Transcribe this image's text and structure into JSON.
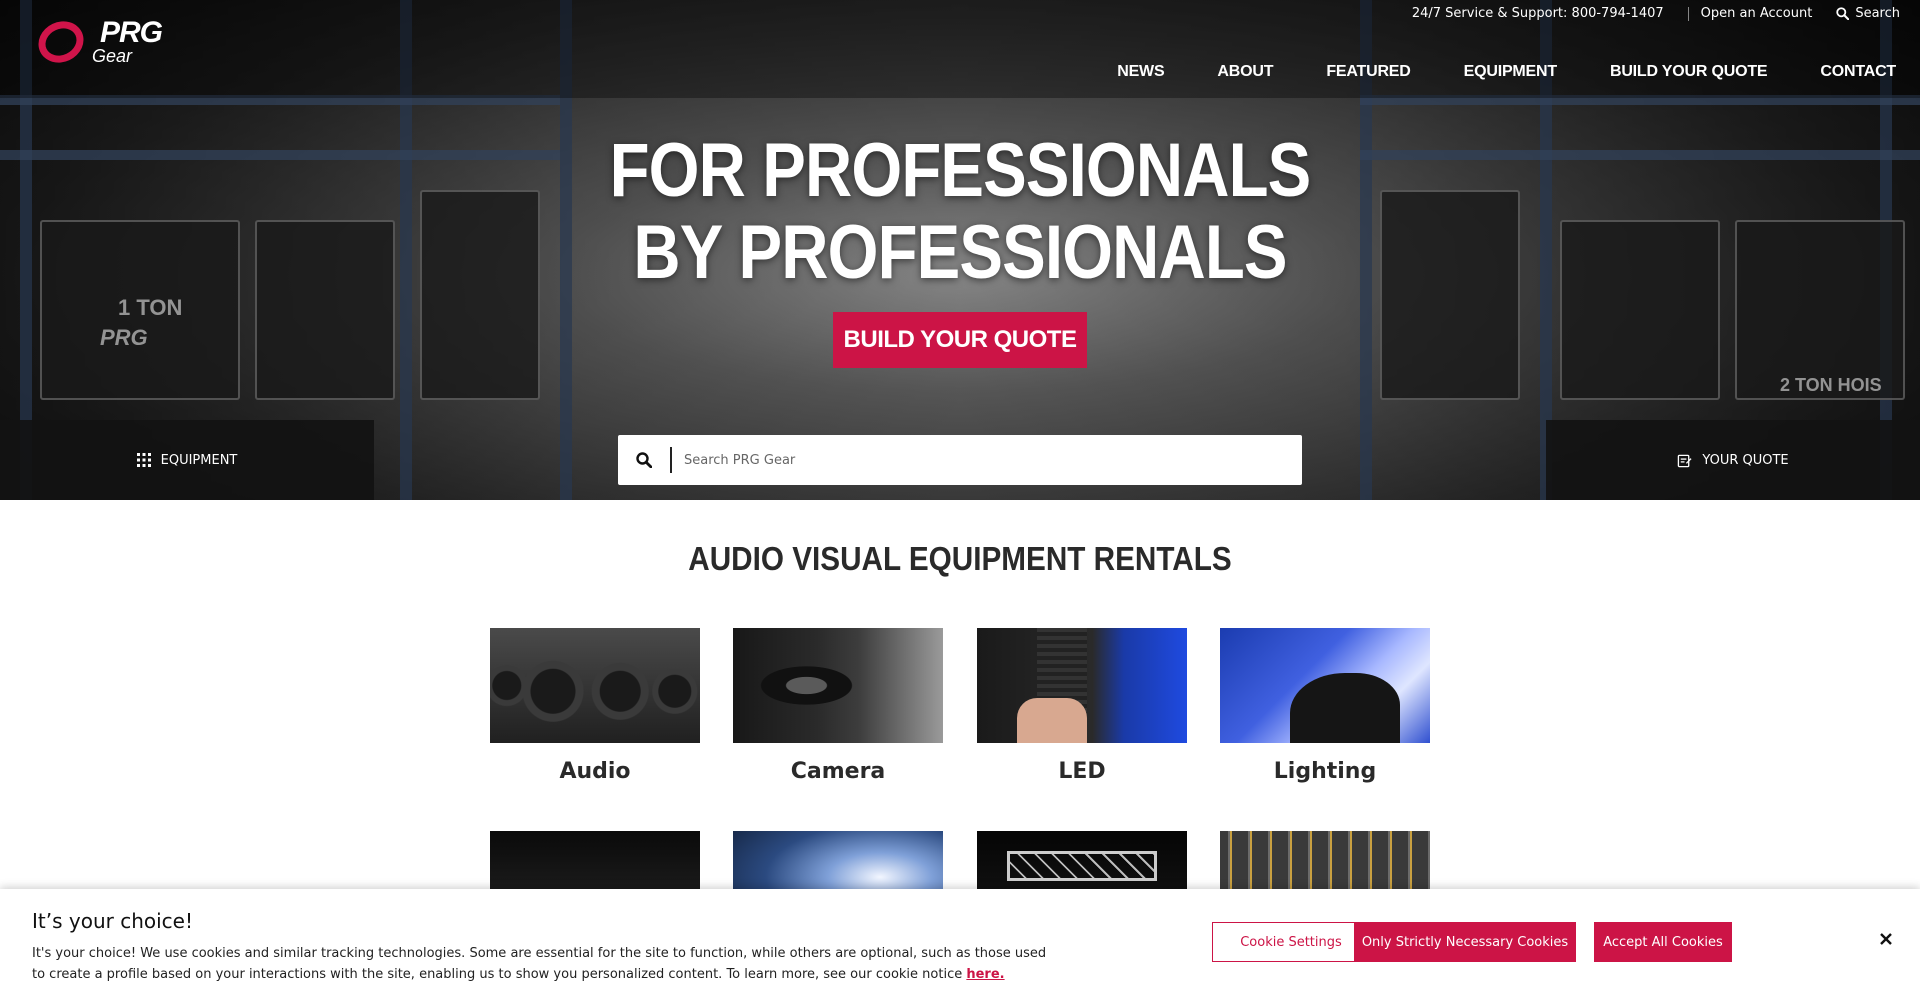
{
  "brand": {
    "logo_primary": "PRG",
    "logo_secondary": "GEAR",
    "accent_color": "#cc1446"
  },
  "utility_bar": {
    "support_label": "24/7 Service & Support:",
    "support_phone": "800-794-1407",
    "account_link": "Open an Account",
    "search_link": "Search"
  },
  "nav": {
    "items": [
      {
        "label": "NEWS"
      },
      {
        "label": "ABOUT"
      },
      {
        "label": "FEATURED"
      },
      {
        "label": "EQUIPMENT"
      },
      {
        "label": "BUILD YOUR QUOTE"
      },
      {
        "label": "CONTACT"
      }
    ]
  },
  "hero": {
    "headline_line1": "FOR PROFESSIONALS",
    "headline_line2": "BY PROFESSIONALS",
    "cta_label": "BUILD YOUR QUOTE",
    "crate_text_1": "1 TON",
    "crate_text_2": "PRG",
    "crate_text_3": "2 TON HOIS"
  },
  "action_bar": {
    "equipment_label": "EQUIPMENT",
    "quote_label": "YOUR QUOTE",
    "search_placeholder": "Search PRG Gear"
  },
  "main": {
    "section_title": "AUDIO VISUAL EQUIPMENT RENTALS",
    "categories": [
      {
        "label": "Audio",
        "icon": "audio-image"
      },
      {
        "label": "Camera",
        "icon": "camera-image"
      },
      {
        "label": "LED",
        "icon": "led-image"
      },
      {
        "label": "Lighting",
        "icon": "lighting-image"
      }
    ]
  },
  "cookie_banner": {
    "title": "It’s your choice!",
    "text": "It's your choice! We use cookies and similar tracking technologies. Some are essential for the site to function, while others are optional, such as those used to create a profile based on your interactions with the site, enabling us to show you personalized content. To learn more, see our cookie notice",
    "link_text": "here.",
    "settings_button": "Cookie Settings",
    "necessary_button": "Only Strictly Necessary Cookies",
    "accept_button": "Accept All Cookies"
  }
}
